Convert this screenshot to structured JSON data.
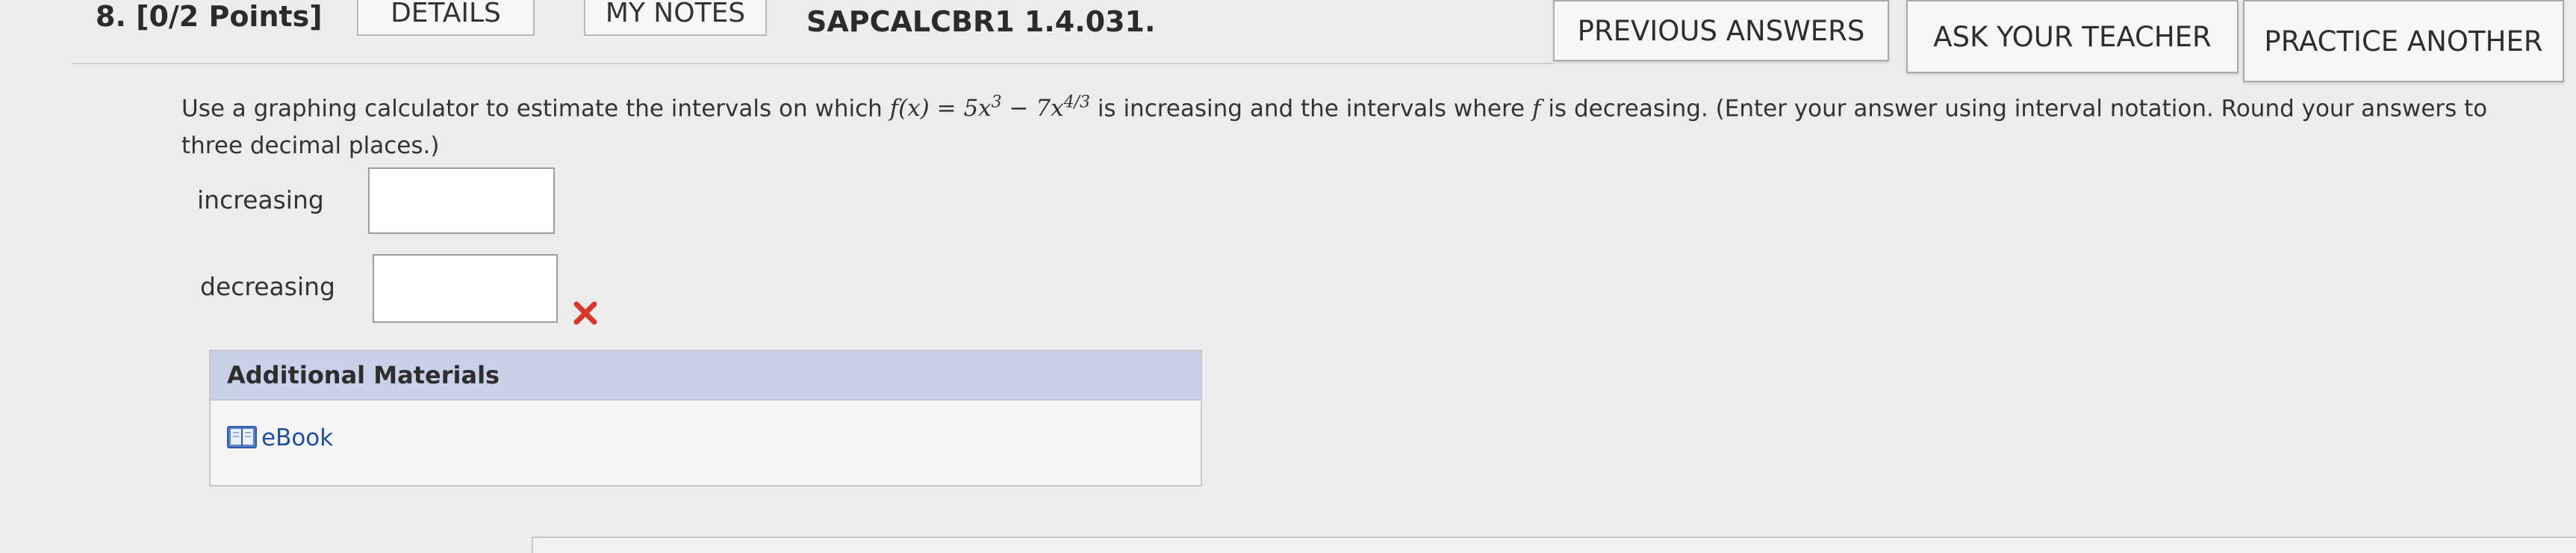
{
  "header": {
    "question_number": "8. [0/2 Points]",
    "tabs": [
      "DETAILS",
      "MY NOTES"
    ],
    "assignment_id": "SAPCALCBR1 1.4.031.",
    "buttons": {
      "previous_answers": "PREVIOUS ANSWERS",
      "ask_teacher": "ASK YOUR TEACHER",
      "practice_another": "PRACTICE ANOTHER"
    }
  },
  "question": {
    "before_function": "Use a graphing calculator to estimate the intervals on which ",
    "function_prefix": "f(x) = 5x",
    "exp1": "3",
    "function_mid": " − 7x",
    "exp2": "4/3",
    "after_function": " is increasing and the intervals where ",
    "f_symbol": "f",
    "instructions": " is decreasing. (Enter your answer using interval notation. Round your answers to three decimal places.)"
  },
  "answers": {
    "increasing_label": "increasing",
    "increasing_value": "",
    "decreasing_label": "decreasing",
    "decreasing_value": "",
    "decreasing_status": "incorrect"
  },
  "materials": {
    "title": "Additional Materials",
    "ebook_label": "eBook"
  },
  "colors": {
    "incorrect_mark": "#d9372b",
    "materials_header": "#c9d1ea",
    "link": "#1f4f9c"
  }
}
